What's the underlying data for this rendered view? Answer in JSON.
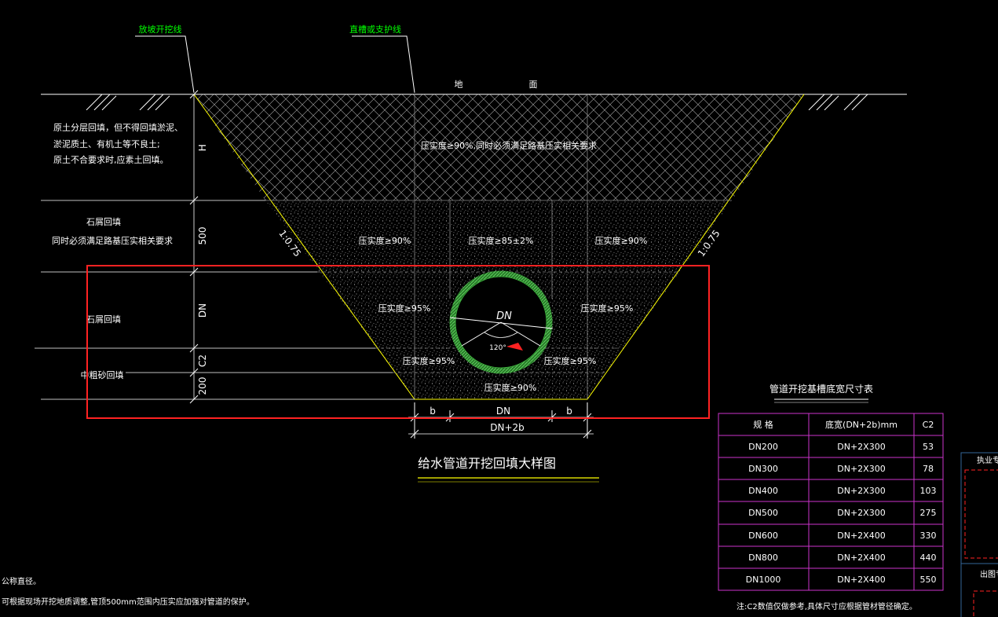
{
  "labels": {
    "slope_excavation_line": "放坡开挖线",
    "trench_support_line": "直槽或支护线",
    "ground_left": "地",
    "ground_right": "面",
    "backfill_note_1": "原土分层回填，但不得回填淤泥、",
    "backfill_note_2": "淤泥质土、有机土等不良土;",
    "backfill_note_3": "原土不合要求时,应素土回填。",
    "stone_chip_backfill_1": "石屑回填",
    "stone_chip_backfill_2": "同时必须满足路基压实相关要求",
    "stone_chip_backfill_3": "石屑回填",
    "coarse_sand_backfill": "中粗砂回填",
    "slope_left": "1:0.75",
    "slope_right": "1:0.75"
  },
  "dimensions": {
    "h": "H",
    "d500": "500",
    "dn": "DN",
    "c2": "C2",
    "d200": "200",
    "b_left": "b",
    "dn_bottom": "DN",
    "b_right": "b",
    "dn2b": "DN+2b"
  },
  "compaction": {
    "top": "压实度≥90%,同时必须满足路基压实相关要求",
    "mid_left": "压实度≥90%",
    "mid_center": "压实度≥85±2%",
    "mid_right": "压实度≥90%",
    "pipe_left": "压实度≥95%",
    "pipe_right": "压实度≥95%",
    "low_left": "压实度≥95%",
    "low_right": "压实度≥95%",
    "bottom": "压实度≥90%"
  },
  "pipe": {
    "dn_label": "DN",
    "angle_label": "120°"
  },
  "drawing_title": "给水管道开挖回填大样图",
  "table": {
    "title": "管道开挖基槽底宽尺寸表",
    "headers": [
      "规 格",
      "底宽(DN+2b)mm",
      "C2"
    ],
    "rows": [
      [
        "DN200",
        "DN+2X300",
        "53"
      ],
      [
        "DN300",
        "DN+2X300",
        "78"
      ],
      [
        "DN400",
        "DN+2X300",
        "103"
      ],
      [
        "DN500",
        "DN+2X300",
        "275"
      ],
      [
        "DN600",
        "DN+2X400",
        "330"
      ],
      [
        "DN800",
        "DN+2X400",
        "440"
      ],
      [
        "DN1000",
        "DN+2X400",
        "550"
      ]
    ],
    "note": "注:C2数值仅做参考,具体尺寸应根据管材管径确定。"
  },
  "bottom_notes": [
    "公称直径。",
    "可根据现场开挖地质调整,管顶500mm范围内压实应加强对管道的保护。"
  ],
  "title_block": {
    "label_top": "执业专",
    "label_bottom": "出图专"
  },
  "colors": {
    "background": "#000000",
    "lines": "#ffffff",
    "leader_text": "#00ff00",
    "slope_lines": "#ffff00",
    "highlight_box": "#ff2222",
    "table_border": "#cc33cc",
    "pipe_ring": "#44cc44"
  }
}
